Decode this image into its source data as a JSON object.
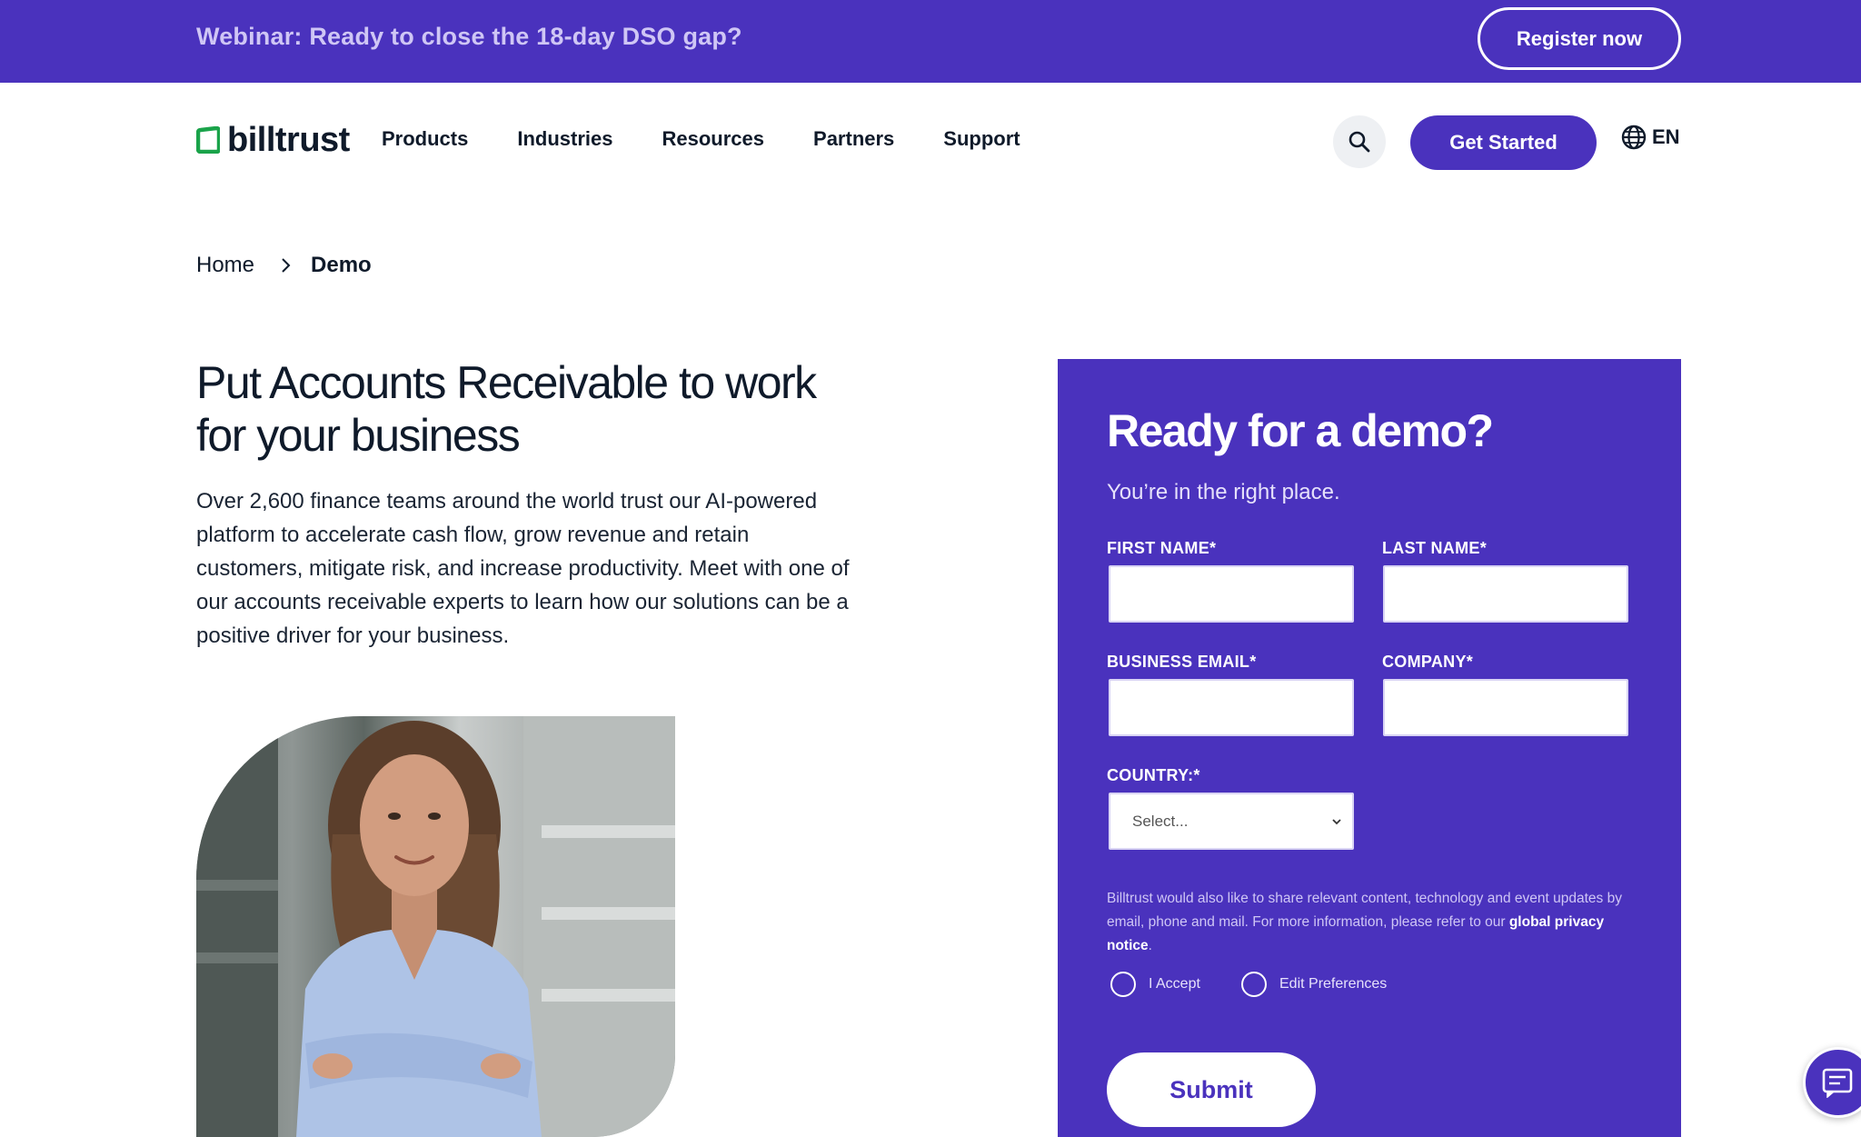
{
  "banner": {
    "text": "Webinar: Ready to close the 18-day DSO gap?",
    "cta_label": "Register now"
  },
  "header": {
    "logo_text": "billtrust",
    "nav": [
      "Products",
      "Industries",
      "Resources",
      "Partners",
      "Support"
    ],
    "search_icon": "search-icon",
    "get_started_label": "Get Started",
    "language": "EN"
  },
  "breadcrumb": {
    "home": "Home",
    "current": "Demo"
  },
  "hero": {
    "title": "Put Accounts Receivable to work for your business",
    "body": "Over 2,600 finance teams around the world trust our AI-powered platform to accelerate cash flow, grow revenue and retain customers, mitigate risk, and increase productivity. Meet with one of our accounts receivable experts to learn how our solutions can be a positive driver for your business."
  },
  "form": {
    "title": "Ready for a demo?",
    "subtitle": "You’re in the right place.",
    "first_name_label": "FIRST NAME*",
    "last_name_label": "LAST NAME*",
    "email_label": "BUSINESS EMAIL*",
    "company_label": "COMPANY*",
    "country_label": "COUNTRY:*",
    "country_value": "Select...",
    "consent_text": "Billtrust would also like to share relevant content, technology and event updates by email, phone and mail. For more information, please refer to our ",
    "consent_link": "global privacy notice",
    "consent_end": ".",
    "radio_accept": "I Accept",
    "radio_edit": "Edit Preferences",
    "submit_label": "Submit"
  },
  "colors": {
    "brand_purple": "#4a32bd",
    "logo_green": "#1aa34a"
  }
}
